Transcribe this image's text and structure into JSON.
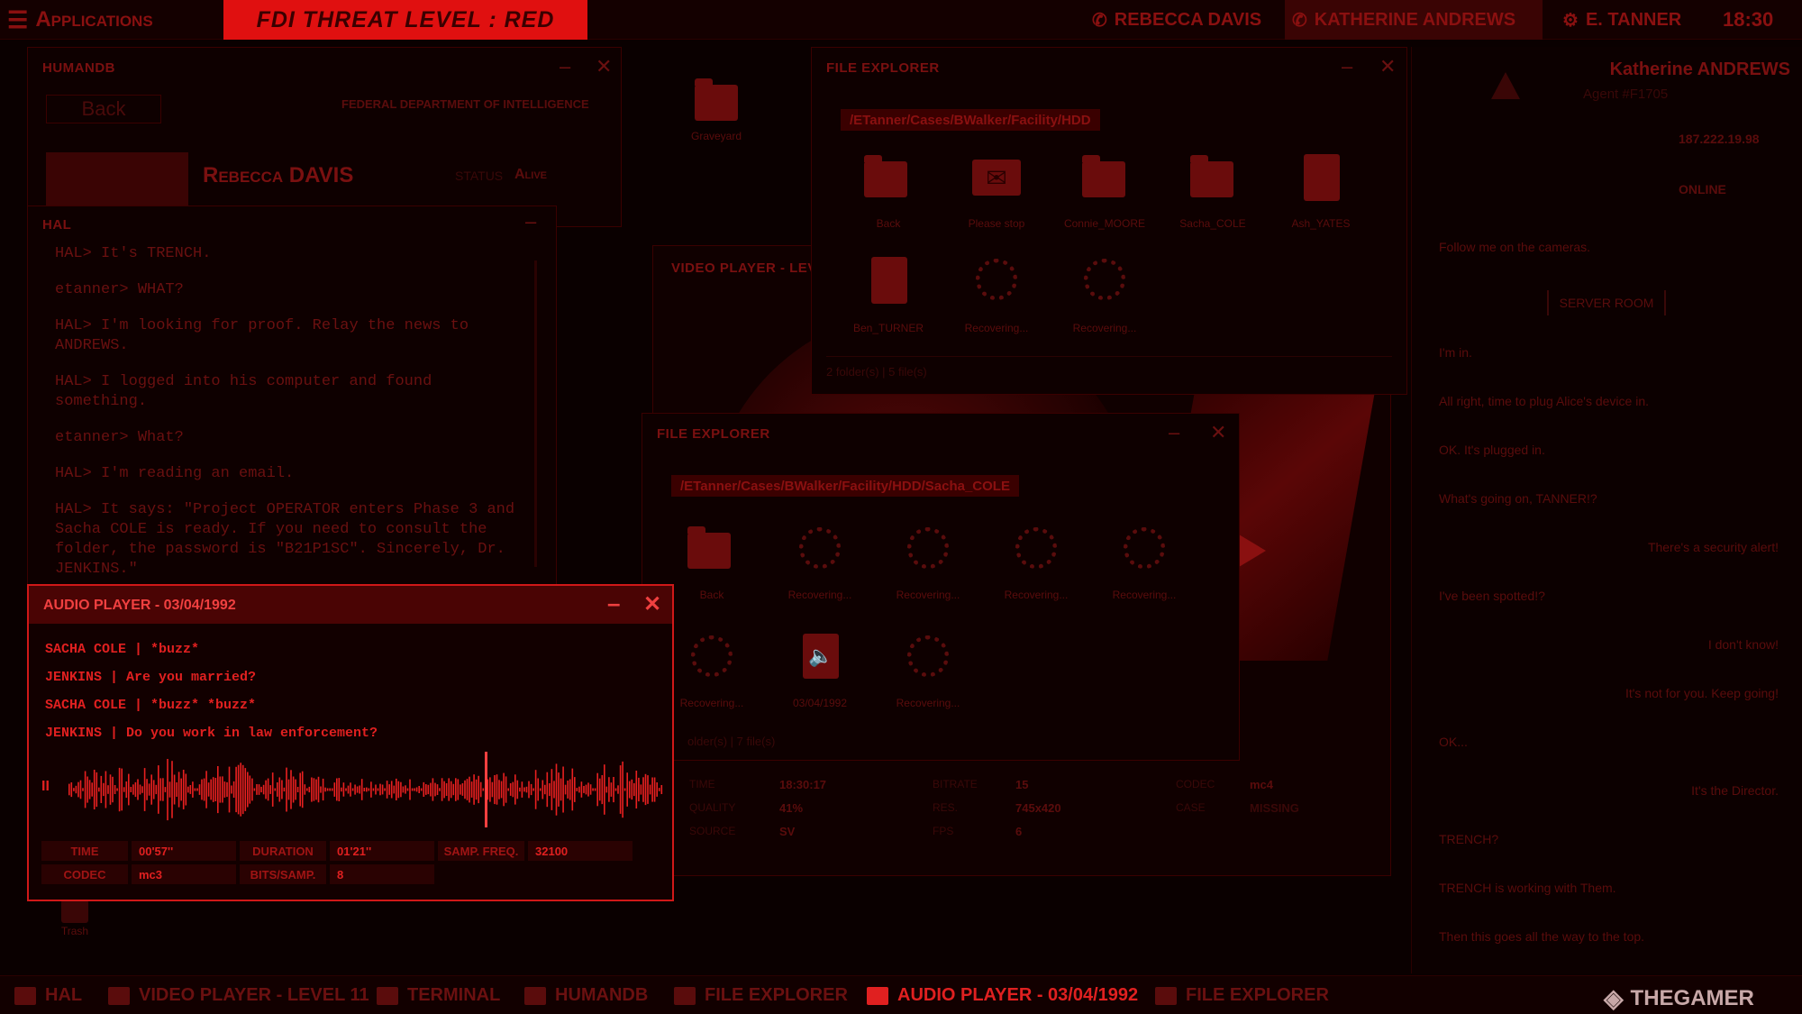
{
  "topbar": {
    "apps_label": "Applications",
    "threat": "FDI THREAT LEVEL : RED",
    "contacts": [
      "REBECCA DAVIS",
      "KATHERINE ANDREWS",
      "E. TANNER"
    ],
    "clock": "18:30"
  },
  "humandb": {
    "title": "HUMANDB",
    "back": "Back",
    "org": "FEDERAL DEPARTMENT OF INTELLIGENCE",
    "name": "Rebecca DAVIS",
    "status_label": "STATUS",
    "status_value": "Alive"
  },
  "hal": {
    "title": "HAL",
    "lines": [
      "HAL> It's TRENCH.",
      "etanner> WHAT?",
      "HAL> I'm looking for proof. Relay the news to ANDREWS.",
      "HAL> I logged into his computer and found something.",
      "etanner> What?",
      "HAL> I'm reading an email.",
      "HAL> It says: \"Project OPERATOR enters Phase 3 and Sacha COLE is ready. If you need to consult the folder, the password is \"B21P1SC\". Sincerely, Dr. JENKINS.\""
    ]
  },
  "desktop": {
    "icons": [
      "Graveyard"
    ],
    "trash": "Trash"
  },
  "video_player": {
    "title": "VIDEO PLAYER - LEV"
  },
  "file_explorer_1": {
    "title": "FILE EXPLORER",
    "path": "/ETanner/Cases/BWalker/Facility/HDD",
    "items": [
      "Back",
      "Please stop",
      "Connie_MOORE",
      "Sacha_COLE",
      "Ash_YATES",
      "Ben_TURNER",
      "Recovering...",
      "Recovering..."
    ],
    "footer": "2 folder(s)  |  5 file(s)"
  },
  "file_explorer_2": {
    "title": "FILE EXPLORER",
    "path": "/ETanner/Cases/BWalker/Facility/HDD/Sacha_COLE",
    "items": [
      "Back",
      "Recovering...",
      "Recovering...",
      "Recovering...",
      "Recovering...",
      "Recovering...",
      "03/04/1992",
      "Recovering..."
    ],
    "footer": "older(s)  |  7 file(s)"
  },
  "video_meta": {
    "rows": [
      [
        "TIME",
        "18:30:17",
        "BITRATE",
        "15",
        "CODEC",
        "mc4"
      ],
      [
        "QUALITY",
        "41%",
        "RES.",
        "745x420",
        "CASE",
        "MISSING"
      ],
      [
        "SOURCE",
        "SV",
        "FPS",
        "6",
        "",
        ""
      ]
    ]
  },
  "audio_player": {
    "title": "AUDIO PLAYER - 03/04/1992",
    "lines": [
      "SACHA COLE | *buzz*",
      "JENKINS | Are you married?",
      "SACHA COLE | *buzz* *buzz*",
      "JENKINS | Do you work in law enforcement?"
    ],
    "pause": "II",
    "meta": {
      "time_label": "TIME",
      "time": "00'57''",
      "duration_label": "DURATION",
      "duration": "01'21''",
      "freq_label": "SAMP. FREQ.",
      "freq": "32100",
      "codec_label": "CODEC",
      "codec": "mc3",
      "bits_label": "BITS/SAMP.",
      "bits": "8"
    }
  },
  "agent_panel": {
    "name": "Katherine ANDREWS",
    "agent_id": "Agent #F1705",
    "ip": "187.222.19.98",
    "status_value": "ONLINE",
    "room": "SERVER ROOM",
    "messages": [
      {
        "text": "Follow me on the cameras.",
        "side": "left"
      },
      {
        "text": "I'm in.",
        "side": "left"
      },
      {
        "text": "All right, time to plug Alice's device in.",
        "side": "left"
      },
      {
        "text": "OK. It's plugged in.",
        "side": "left"
      },
      {
        "text": "What's going on, TANNER!?",
        "side": "left"
      },
      {
        "text": "There's a security alert!",
        "side": "right"
      },
      {
        "text": "I've been spotted!?",
        "side": "left"
      },
      {
        "text": "I don't know!",
        "side": "right"
      },
      {
        "text": "It's not for you. Keep going!",
        "side": "right"
      },
      {
        "text": "OK...",
        "side": "left"
      },
      {
        "text": "It's the Director.",
        "side": "right"
      },
      {
        "text": "TRENCH?",
        "side": "left"
      },
      {
        "text": "TRENCH is working with Them.",
        "side": "left"
      },
      {
        "text": "Then this goes all the way to the top.",
        "side": "left"
      }
    ]
  },
  "taskbar": {
    "items": [
      "HAL",
      "VIDEO PLAYER - LEVEL 11",
      "TERMINAL",
      "HUMANDB",
      "FILE EXPLORER",
      "AUDIO PLAYER - 03/04/1992",
      "FILE EXPLORER"
    ],
    "active_index": 5
  },
  "watermark": "THEGAMER",
  "waveform": {
    "playhead": 0.7
  },
  "colors": {
    "accent": "#e02020",
    "dim": "#5a0c0c",
    "background": "#0a0000",
    "threat_bg": "#e01010"
  }
}
